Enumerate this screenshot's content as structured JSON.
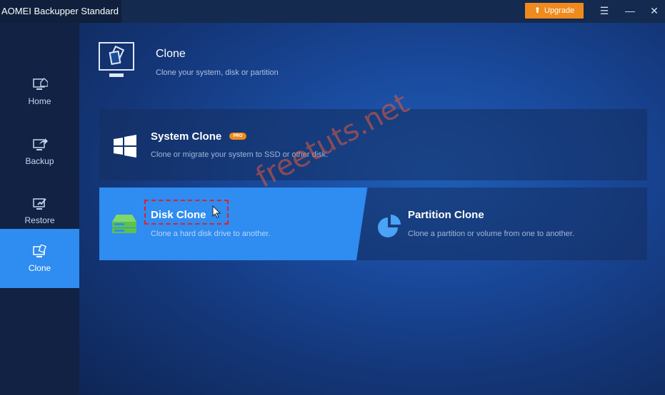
{
  "titlebar": {
    "app_title": "AOMEI Backupper Standard",
    "upgrade_label": "Upgrade",
    "menu_icon": "hamburger-menu-icon",
    "minimize_icon": "minimize-icon",
    "close_icon": "close-icon"
  },
  "sidebar": {
    "items": [
      {
        "label": "Home",
        "icon": "home-icon",
        "active": false
      },
      {
        "label": "Backup",
        "icon": "backup-icon",
        "active": false
      },
      {
        "label": "Restore",
        "icon": "restore-icon",
        "active": false
      },
      {
        "label": "Clone",
        "icon": "clone-icon",
        "active": true
      }
    ]
  },
  "header": {
    "title": "Clone",
    "subtitle": "Clone your system, disk or partition"
  },
  "cards": {
    "system_clone": {
      "title": "System Clone",
      "badge": "PRO",
      "description": "Clone or migrate your system to SSD or other disk."
    },
    "disk_clone": {
      "title": "Disk Clone",
      "description": "Clone a hard disk drive to another."
    },
    "partition_clone": {
      "title": "Partition Clone",
      "description": "Clone a partition or volume from one to another."
    }
  },
  "watermark": "freetuts.net",
  "colors": {
    "accent": "#2f8cf0",
    "upgrade": "#f08a1c",
    "highlight": "#e0202a"
  }
}
